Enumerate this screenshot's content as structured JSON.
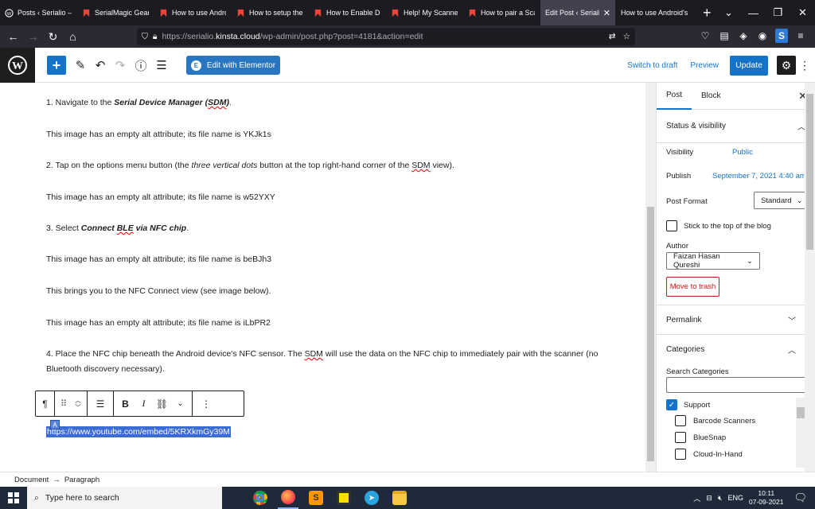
{
  "browser": {
    "tabs": [
      {
        "title": "Posts ‹ Serialio — Wo",
        "icon": "wp-icon"
      },
      {
        "title": "SerialMagic Gears",
        "icon": "bookmark-icon"
      },
      {
        "title": "How to use Andro",
        "icon": "bookmark-icon"
      },
      {
        "title": "How to setup the",
        "icon": "bookmark-icon"
      },
      {
        "title": "How to Enable De",
        "icon": "bookmark-icon"
      },
      {
        "title": "Help! My Scanner",
        "icon": "bookmark-icon"
      },
      {
        "title": "How to pair a Sca",
        "icon": "bookmark-icon"
      },
      {
        "title": "Edit Post ‹ Serialio",
        "icon": "none",
        "active": true
      },
      {
        "title": "How to use Android's",
        "icon": "none"
      }
    ],
    "url_prefix": "https://serialio.",
    "url_host": "kinsta.cloud",
    "url_suffix": "/wp-admin/post.php?post=4181&action=edit"
  },
  "editor_toolbar": {
    "elementor_label": "Edit with Elementor",
    "switch_draft": "Switch to draft",
    "preview": "Preview",
    "update": "Update"
  },
  "content": {
    "p1_prefix": "1. Navigate to the ",
    "p1_bold": "Serial Device Manager (",
    "p1_sdm": "SDM",
    "p1_bold_end": ")",
    "p1_end": ".",
    "alt1": "This image has an empty alt attribute; its file name is YKJk1s",
    "p2_prefix": "2. Tap on the options menu button (the ",
    "p2_italic": "three vertical dots",
    "p2_mid": " button at the top right-hand corner of the ",
    "p2_sdm": "SDM",
    "p2_end": " view).",
    "alt2": "This image has an empty alt attribute; its file name is w52YXY",
    "p3_prefix": "3. Select ",
    "p3_b1": "Connect ",
    "p3_ble": "BLE",
    "p3_b2": " via NFC chip",
    "p3_end": ".",
    "alt3": "This image has an empty alt attribute; its file name is beBJh3",
    "p_nfc": "This brings you to the NFC Connect view (see image below).",
    "alt4": "This image has an empty alt attribute; its file name is iLbPR2",
    "p4_prefix": "4. Place the NFC chip beneath the Android device's NFC sensor. The ",
    "p4_sdm": "SDM",
    "p4_end": " will use the data on the NFC chip to immediately pair with the scanner (no Bluetooth discovery necessary).",
    "embed_url": "https://www.youtube.com/embed/5KRXkmGy39M"
  },
  "sidebar": {
    "tab_post": "Post",
    "tab_block": "Block",
    "status_heading": "Status & visibility",
    "visibility_label": "Visibility",
    "visibility_value": "Public",
    "publish_label": "Publish",
    "publish_value": "September 7, 2021 4:40 am",
    "format_label": "Post Format",
    "format_value": "Standard",
    "sticky_label": "Stick to the top of the blog",
    "author_label": "Author",
    "author_value": "Faizan Hasan Qureshi",
    "trash_label": "Move to trash",
    "permalink_heading": "Permalink",
    "categories_heading": "Categories",
    "search_categories": "Search Categories",
    "categories": [
      {
        "label": "Support",
        "checked": true
      },
      {
        "label": "Barcode Scanners",
        "checked": false
      },
      {
        "label": "BlueSnap",
        "checked": false
      },
      {
        "label": "Cloud-In-Hand",
        "checked": false
      }
    ]
  },
  "footer": {
    "breadcrumb_doc": "Document",
    "breadcrumb_arrow": "→",
    "breadcrumb_block": "Paragraph"
  },
  "taskbar": {
    "search_placeholder": "Type here to search",
    "lang": "ENG",
    "time": "10:11",
    "date": "07-09-2021"
  },
  "colors": {
    "accent": "#1473c9",
    "elementor": "#2876c2",
    "danger": "#cc1818",
    "selection": "#3b6cd4"
  }
}
